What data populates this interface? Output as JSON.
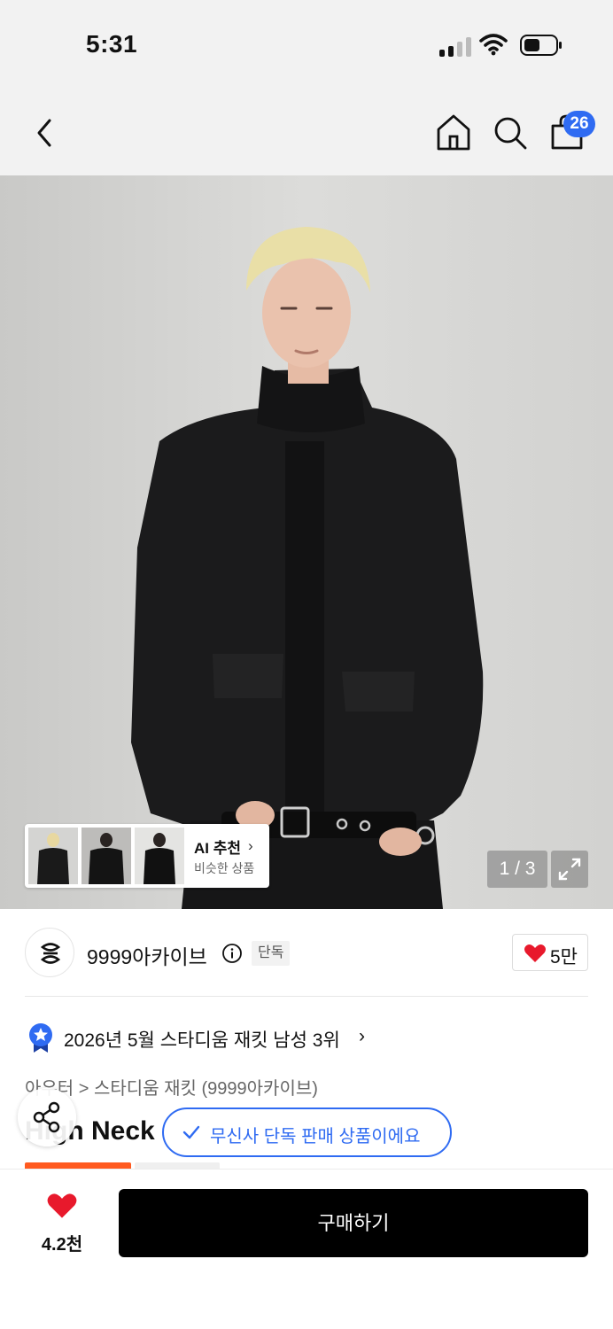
{
  "status_bar": {
    "time": "5:31"
  },
  "nav": {
    "cart_count": "26"
  },
  "hero": {
    "page_counter": "1 / 3",
    "ai_recommend": {
      "title": "AI 추천",
      "subtitle": "비슷한 상품"
    }
  },
  "brand": {
    "name": "9999아카이브",
    "tag": "단독",
    "like_count": "5만"
  },
  "ranking": {
    "text": "2026년 5월 스타디움 재킷 남성 3위"
  },
  "breadcrumb": {
    "text": "아우터 > 스타디움 재킷 (9999아카이브)"
  },
  "product": {
    "title_visible": "High Neck",
    "exclusive_notice": "무신사 단독 판매 상품이에요"
  },
  "bottom_bar": {
    "like_count": "4.2천",
    "buy_label": "구매하기"
  },
  "colors": {
    "accent_blue": "#2f6bf2",
    "heart_red": "#e8192c",
    "buy_black": "#000000"
  },
  "icons": [
    "back-icon",
    "home-icon",
    "search-icon",
    "cart-icon",
    "expand-icon",
    "info-icon",
    "heart-icon",
    "ranking-badge-icon",
    "check-icon",
    "share-icon"
  ]
}
